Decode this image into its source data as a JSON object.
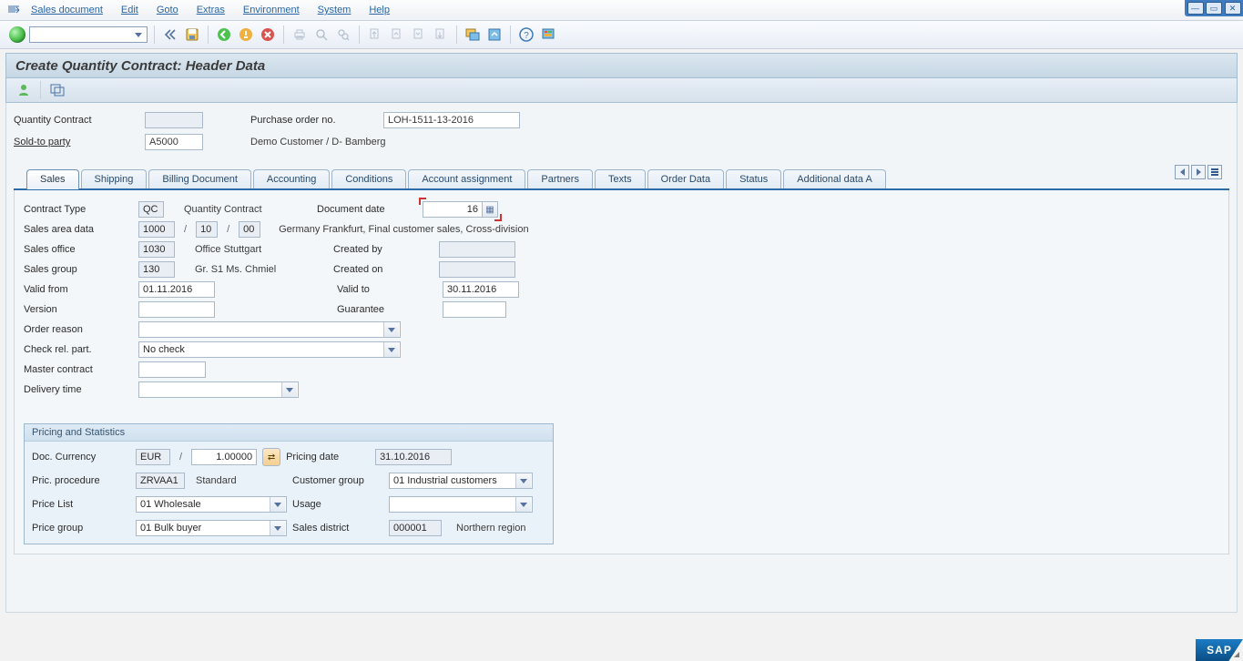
{
  "menu": {
    "items": [
      "Sales document",
      "Edit",
      "Goto",
      "Extras",
      "Environment",
      "System",
      "Help"
    ]
  },
  "toolbar": {
    "icons": [
      "back-double",
      "save",
      "back-green",
      "exit-yellow",
      "cancel-red",
      "print",
      "find",
      "find-next",
      "first",
      "prev",
      "next",
      "last",
      "new-session",
      "layout",
      "help",
      "customize"
    ]
  },
  "title": "Create Quantity Contract: Header Data",
  "appbar": {
    "icons": [
      "display-sold-to-party",
      "header-overview"
    ]
  },
  "header": {
    "quantity_contract_label": "Quantity Contract",
    "quantity_contract_value": "",
    "po_label": "Purchase order no.",
    "po_value": "LOH-1511-13-2016",
    "sold_to_label": "Sold-to party",
    "sold_to_value": "A5000",
    "sold_to_desc": "Demo Customer / D- Bamberg"
  },
  "tabs": [
    "Sales",
    "Shipping",
    "Billing Document",
    "Accounting",
    "Conditions",
    "Account assignment",
    "Partners",
    "Texts",
    "Order Data",
    "Status",
    "Additional data A"
  ],
  "active_tab_index": 0,
  "form": {
    "contract_type_label": "Contract Type",
    "contract_type_value": "QC",
    "contract_type_desc": "Quantity Contract",
    "document_date_label": "Document date",
    "document_date_value": "16",
    "sales_area_label": "Sales area data",
    "sales_area_org": "1000",
    "sales_area_chan": "10",
    "sales_area_div": "00",
    "sales_area_desc": "Germany Frankfurt, Final customer sales, Cross-division",
    "sales_office_label": "Sales office",
    "sales_office_value": "1030",
    "sales_office_desc": "Office Stuttgart",
    "created_by_label": "Created by",
    "created_by_value": "",
    "sales_group_label": "Sales group",
    "sales_group_value": "130",
    "sales_group_desc": "Gr. S1 Ms. Chmiel",
    "created_on_label": "Created on",
    "created_on_value": "",
    "valid_from_label": "Valid from",
    "valid_from_value": "01.11.2016",
    "valid_to_label": "Valid to",
    "valid_to_value": "30.11.2016",
    "version_label": "Version",
    "version_value": "",
    "guarantee_label": "Guarantee",
    "guarantee_value": "",
    "order_reason_label": "Order reason",
    "order_reason_value": "",
    "check_rel_label": "Check rel. part.",
    "check_rel_value": "No check",
    "master_contract_label": "Master contract",
    "master_contract_value": "",
    "delivery_time_label": "Delivery time",
    "delivery_time_value": ""
  },
  "pricing": {
    "section_title": "Pricing and Statistics",
    "doc_currency_label": "Doc. Currency",
    "doc_currency_value": "EUR",
    "exchange_rate_value": "1.00000",
    "pricing_date_label": "Pricing date",
    "pricing_date_value": "31.10.2016",
    "pric_procedure_label": "Pric. procedure",
    "pric_procedure_value": "ZRVAA1",
    "pric_procedure_desc": "Standard",
    "customer_group_label": "Customer group",
    "customer_group_value": "01 Industrial customers",
    "price_list_label": "Price List",
    "price_list_value": "01 Wholesale",
    "usage_label": "Usage",
    "usage_value": "",
    "price_group_label": "Price group",
    "price_group_value": "01 Bulk buyer",
    "sales_district_label": "Sales district",
    "sales_district_value": "000001",
    "sales_district_desc": "Northern region"
  },
  "footer": {
    "logo": "SAP"
  }
}
